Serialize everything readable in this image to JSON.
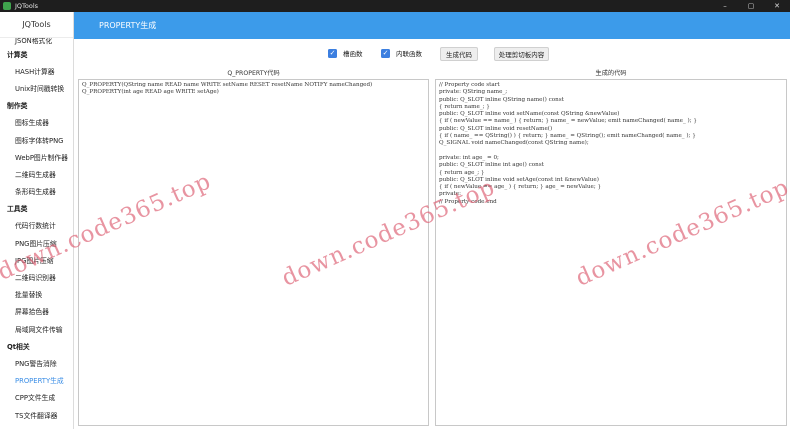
{
  "window": {
    "title": "JQTools",
    "controls": {
      "minimize": "–",
      "maximize": "▢",
      "close": "✕"
    }
  },
  "sidebar": {
    "brand": "JQTools",
    "items": [
      {
        "label": "JSON格式化",
        "type": "item",
        "partial": true
      },
      {
        "label": "计算类",
        "type": "category"
      },
      {
        "label": "HASH计算器",
        "type": "item"
      },
      {
        "label": "Unix时间戳转换",
        "type": "item"
      },
      {
        "label": "制作类",
        "type": "category"
      },
      {
        "label": "图标生成器",
        "type": "item"
      },
      {
        "label": "图标字体转PNG",
        "type": "item"
      },
      {
        "label": "WebP图片制作器",
        "type": "item"
      },
      {
        "label": "二维码生成器",
        "type": "item"
      },
      {
        "label": "条形码生成器",
        "type": "item"
      },
      {
        "label": "工具类",
        "type": "category"
      },
      {
        "label": "代码行数统计",
        "type": "item"
      },
      {
        "label": "PNG图片压缩",
        "type": "item"
      },
      {
        "label": "JPG图片压缩",
        "type": "item"
      },
      {
        "label": "二维码识别器",
        "type": "item"
      },
      {
        "label": "批量替换",
        "type": "item"
      },
      {
        "label": "屏幕拾色器",
        "type": "item"
      },
      {
        "label": "局域网文件传输",
        "type": "item"
      },
      {
        "label": "Qt相关",
        "type": "category"
      },
      {
        "label": "PNG警告消除",
        "type": "item"
      },
      {
        "label": "PROPERTY生成",
        "type": "item",
        "active": true
      },
      {
        "label": "CPP文件生成",
        "type": "item"
      },
      {
        "label": "TS文件翻译器",
        "type": "item"
      }
    ]
  },
  "header": {
    "title": "PROPERTY生成"
  },
  "toolbar": {
    "checkbox_slot": {
      "label": "槽函数",
      "checked": true
    },
    "checkbox_inline": {
      "label": "内联函数",
      "checked": true
    },
    "generate_label": "生成代码",
    "clipboard_label": "处理剪切板内容"
  },
  "input_panel": {
    "label": "Q_PROPERTY代码",
    "text": "Q_PROPERTY(QString name READ name WRITE setName RESET resetName NOTIFY nameChanged)\nQ_PROPERTY(int age READ age WRITE setAge)"
  },
  "output_panel": {
    "label": "生成的代码",
    "text": "// Property code start\nprivate: QString name_;\npublic: Q_SLOT inline QString name() const\n{ return name_; }\npublic: Q_SLOT inline void setName(const QString &newValue)\n{ if ( newValue == name_ ) { return; } name_ = newValue; emit nameChanged( name_ ); }\npublic: Q_SLOT inline void resetName()\n{ if ( name_ == QString() ) { return; } name_ = QString(); emit nameChanged( name_ ); }\nQ_SIGNAL void nameChanged(const QString name);\n\nprivate: int age_ = 0;\npublic: Q_SLOT inline int age() const\n{ return age_; }\npublic: Q_SLOT inline void setAge(const int &newValue)\n{ if ( newValue == age_ ) { return; } age_ = newValue; }\nprivate:\n// Property code end"
  },
  "watermark": {
    "text": "down.code365.top",
    "color": "#dc5a6e"
  }
}
